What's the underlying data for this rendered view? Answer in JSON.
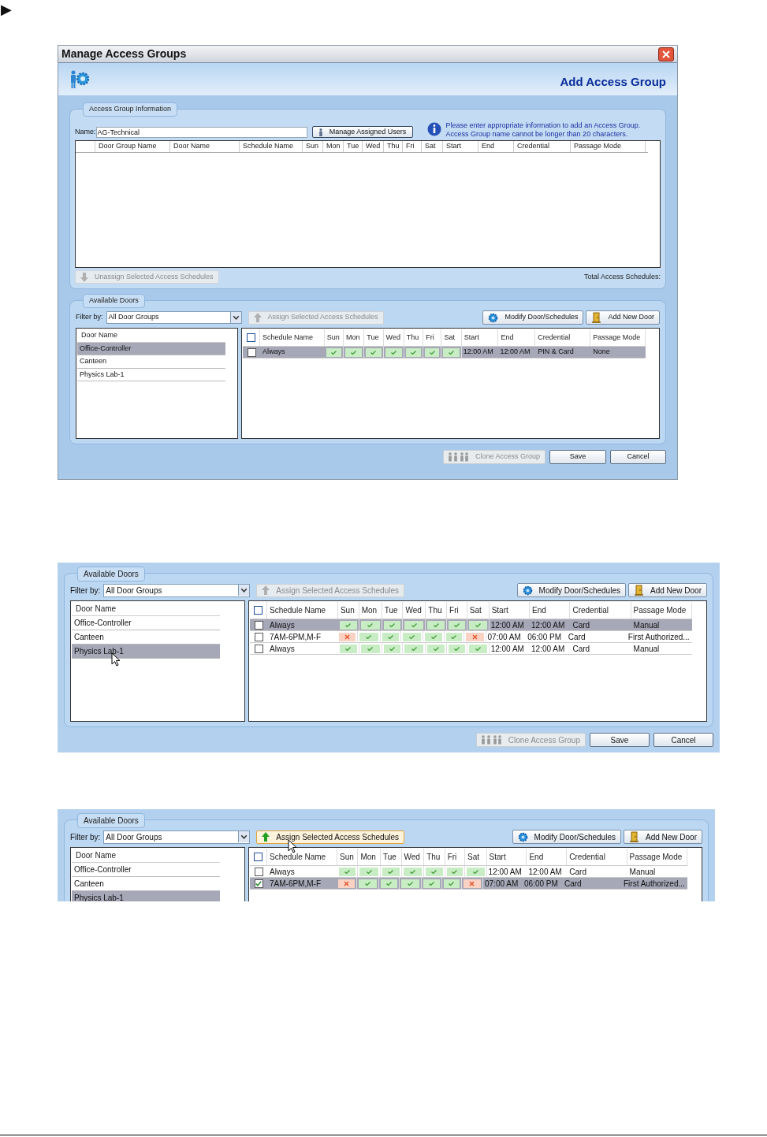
{
  "marker": "▶",
  "dialog": {
    "title": "Manage Access Groups",
    "heading": "Add Access Group",
    "info": {
      "legend": "Access Group Information",
      "name_label": "Name:",
      "name_value": "AG-Technical",
      "manage_button": "Manage Assigned Users",
      "message": "Please enter appropriate information to add an Access Group. Access Group name cannot be longer than 20 characters.",
      "columns": [
        "Door Group Name",
        "Door Name",
        "Schedule Name",
        "Sun",
        "Mon",
        "Tue",
        "Wed",
        "Thu",
        "Fri",
        "Sat",
        "Start",
        "End",
        "Credential",
        "Passage Mode"
      ],
      "unassign_button": {
        "label": "Unassign Selected Access Schedules",
        "enabled": false
      },
      "total_label": "Total Access Schedules:"
    },
    "available": {
      "legend": "Available Doors",
      "filter_label": "Filter by:",
      "filter_value": "All Door Groups",
      "assign_button": {
        "label": "Assign Selected Access Schedules",
        "enabled": false
      },
      "modify_button": "Modify Door/Schedules",
      "add_door_button": "Add New Door",
      "door_header": "Door Name",
      "all_checked": false,
      "doors": [
        {
          "name": "Office-Controller",
          "selected": true
        },
        {
          "name": "Canteen",
          "selected": false
        },
        {
          "name": "Physics Lab-1",
          "selected": false
        }
      ],
      "schedule_columns": [
        "Schedule Name",
        "Sun",
        "Mon",
        "Tue",
        "Wed",
        "Thu",
        "Fri",
        "Sat",
        "Start",
        "End",
        "Credential",
        "Passage Mode"
      ],
      "schedules": [
        {
          "name": "Always",
          "checked": false,
          "selected": true,
          "days": [
            {
              "allowed": true
            },
            {
              "allowed": true
            },
            {
              "allowed": true
            },
            {
              "allowed": true
            },
            {
              "allowed": true
            },
            {
              "allowed": true
            },
            {
              "allowed": true
            }
          ],
          "start": "12:00 AM",
          "end": "12:00 AM",
          "credential": "PIN & Card",
          "passage_mode": "None"
        }
      ]
    },
    "footer": {
      "clone_button": {
        "label": "Clone Access Group",
        "enabled": false
      },
      "save_button": "Save",
      "cancel_button": "Cancel"
    }
  },
  "snippets": [
    {
      "available": {
        "legend": "Available Doors",
        "filter_label": "Filter by:",
        "filter_value": "All Door Groups",
        "assign_button": {
          "label": "Assign Selected Access Schedules",
          "enabled": false
        },
        "modify_button": "Modify Door/Schedules",
        "add_door_button": "Add New Door",
        "door_header": "Door Name",
        "all_checked": false,
        "doors": [
          {
            "name": "Office-Controller",
            "selected": false
          },
          {
            "name": "Canteen",
            "selected": false
          },
          {
            "name": "Physics Lab-1",
            "selected": true
          }
        ],
        "schedule_columns": [
          "Schedule Name",
          "Sun",
          "Mon",
          "Tue",
          "Wed",
          "Thu",
          "Fri",
          "Sat",
          "Start",
          "End",
          "Credential",
          "Passage Mode"
        ],
        "schedules": [
          {
            "name": "Always",
            "checked": false,
            "selected": true,
            "days": [
              {
                "allowed": true
              },
              {
                "allowed": true
              },
              {
                "allowed": true
              },
              {
                "allowed": true
              },
              {
                "allowed": true
              },
              {
                "allowed": true
              },
              {
                "allowed": true
              }
            ],
            "start": "12:00 AM",
            "end": "12:00 AM",
            "credential": "Card",
            "passage_mode": "Manual"
          },
          {
            "name": "7AM-6PM,M-F",
            "checked": false,
            "selected": false,
            "days": [
              {
                "allowed": false
              },
              {
                "allowed": true
              },
              {
                "allowed": true
              },
              {
                "allowed": true
              },
              {
                "allowed": true
              },
              {
                "allowed": true
              },
              {
                "allowed": false
              }
            ],
            "start": "07:00 AM",
            "end": "06:00 PM",
            "credential": "Card",
            "passage_mode": "First Authorized..."
          },
          {
            "name": "Always",
            "checked": false,
            "selected": false,
            "days": [
              {
                "allowed": true
              },
              {
                "allowed": true
              },
              {
                "allowed": true
              },
              {
                "allowed": true
              },
              {
                "allowed": true
              },
              {
                "allowed": true
              },
              {
                "allowed": true
              }
            ],
            "start": "12:00 AM",
            "end": "12:00 AM",
            "credential": "Card",
            "passage_mode": "Manual"
          }
        ]
      },
      "footer": {
        "clone_button": {
          "label": "Clone Access Group",
          "enabled": false
        },
        "save_button": "Save",
        "cancel_button": "Cancel"
      }
    },
    {
      "available": {
        "legend": "Available Doors",
        "filter_label": "Filter by:",
        "filter_value": "All Door Groups",
        "assign_button": {
          "label": "Assign Selected Access Schedules",
          "enabled": true
        },
        "modify_button": "Modify Door/Schedules",
        "add_door_button": "Add New Door",
        "door_header": "Door Name",
        "all_checked": false,
        "doors": [
          {
            "name": "Office-Controller",
            "selected": false
          },
          {
            "name": "Canteen",
            "selected": false
          },
          {
            "name": "Physics Lab-1",
            "selected": true
          }
        ],
        "schedule_columns": [
          "Schedule Name",
          "Sun",
          "Mon",
          "Tue",
          "Wed",
          "Thu",
          "Fri",
          "Sat",
          "Start",
          "End",
          "Credential",
          "Passage Mode"
        ],
        "schedules": [
          {
            "name": "Always",
            "checked": false,
            "selected": false,
            "days": [
              {
                "allowed": true
              },
              {
                "allowed": true
              },
              {
                "allowed": true
              },
              {
                "allowed": true
              },
              {
                "allowed": true
              },
              {
                "allowed": true
              },
              {
                "allowed": true
              }
            ],
            "start": "12:00 AM",
            "end": "12:00 AM",
            "credential": "Card",
            "passage_mode": "Manual"
          },
          {
            "name": "7AM-6PM,M-F",
            "checked": true,
            "selected": true,
            "days": [
              {
                "allowed": false
              },
              {
                "allowed": true
              },
              {
                "allowed": true
              },
              {
                "allowed": true
              },
              {
                "allowed": true
              },
              {
                "allowed": true
              },
              {
                "allowed": false
              }
            ],
            "start": "07:00 AM",
            "end": "06:00 PM",
            "credential": "Card",
            "passage_mode": "First Authorized..."
          }
        ]
      }
    }
  ]
}
